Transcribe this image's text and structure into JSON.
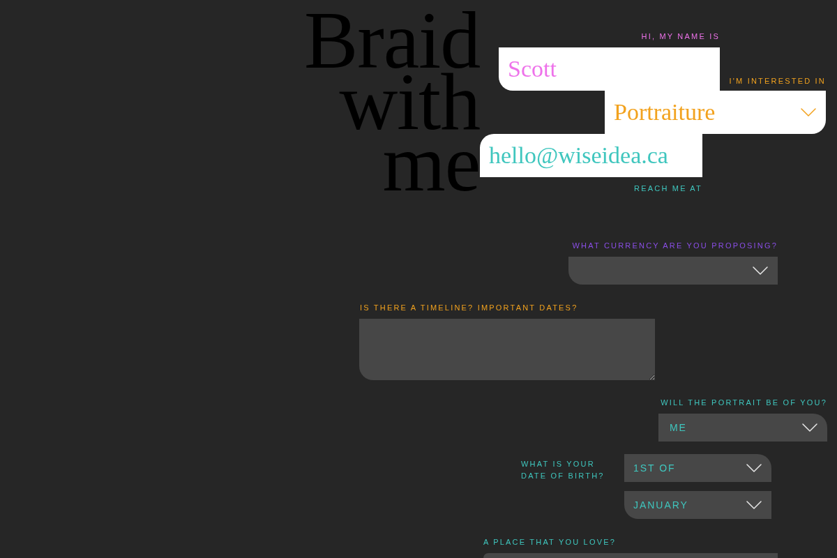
{
  "headline": "Braid with me",
  "intro_fields": [
    {
      "kind": "text",
      "label": "HI, MY NAME IS",
      "value": "Scott",
      "color": "#ee72ea"
    },
    {
      "kind": "select",
      "label": "I'M INTERESTED IN",
      "value": "Portraiture",
      "color": "#f2a21e"
    },
    {
      "kind": "text",
      "label": "REACH ME AT",
      "value": "hello@wiseidea.ca",
      "color": "#3fc6be"
    }
  ],
  "questions": [
    {
      "kind": "select",
      "label": "WHAT CURRENCY ARE YOU PROPOSING?",
      "color": "#8a4ee6"
    },
    {
      "kind": "textarea",
      "label": "IS THERE A TIMELINE? IMPORTANT DATES?",
      "color": "#f2a21e"
    },
    {
      "kind": "select",
      "label": "WILL THE PORTRAIT BE OF YOU?",
      "value": "ME",
      "color": "#3fc6be"
    },
    {
      "kind": "date",
      "label": "WHAT IS YOUR DATE OF BIRTH?",
      "day": "1ST OF",
      "month": "JANUARY",
      "color": "#3fc6be"
    },
    {
      "kind": "text",
      "label": "A PLACE THAT YOU LOVE?",
      "color": "#3fc6be"
    }
  ]
}
